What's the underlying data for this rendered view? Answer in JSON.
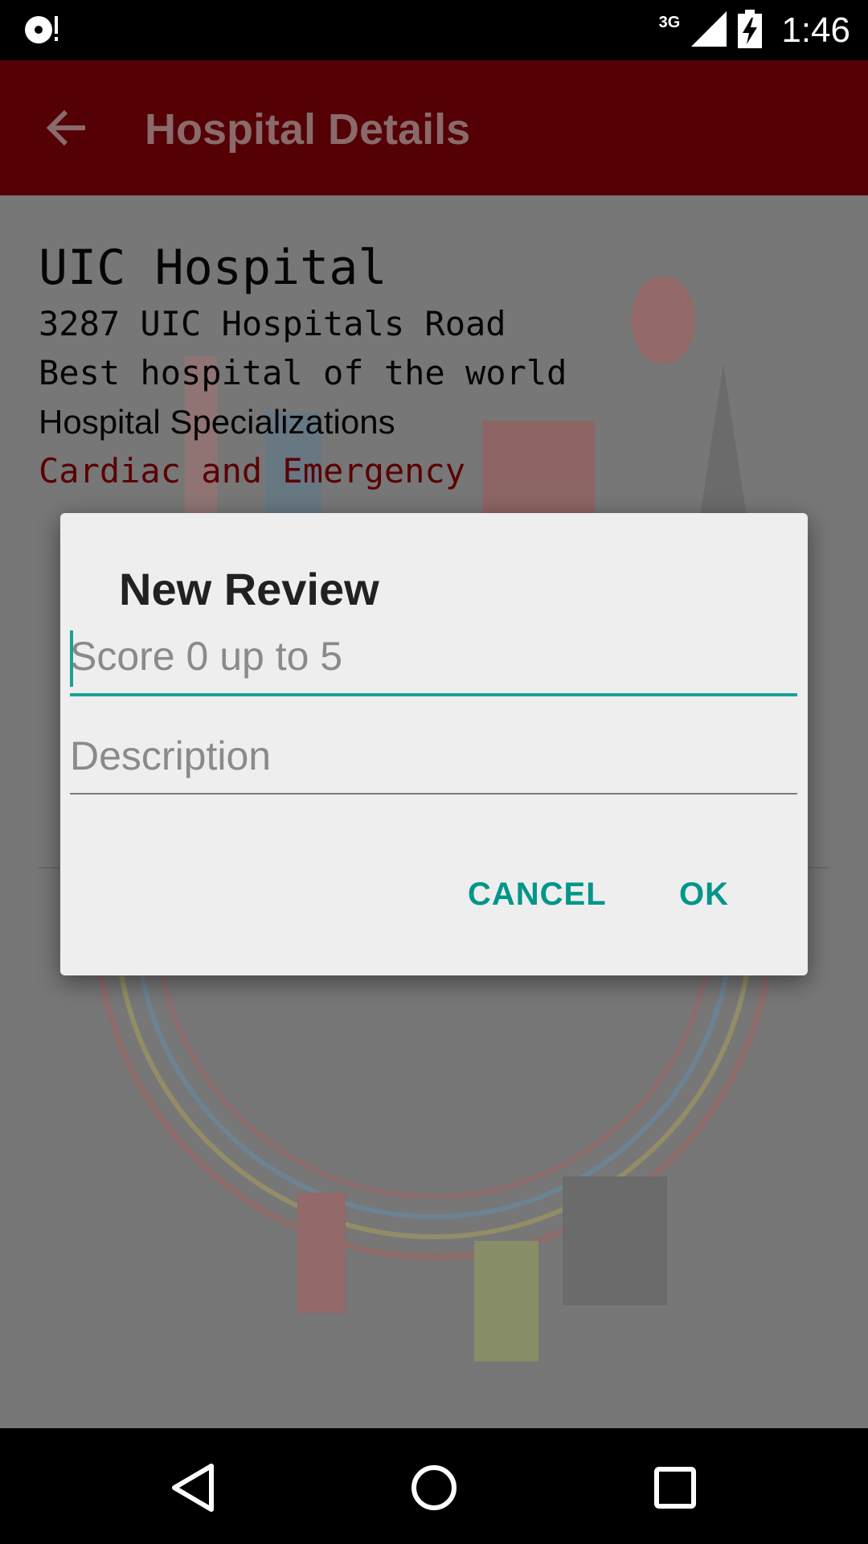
{
  "status_bar": {
    "network_type": "3G",
    "time": "1:46"
  },
  "toolbar": {
    "title": "Hospital Details",
    "back_icon": "arrow-back-icon"
  },
  "hospital": {
    "name": "UIC Hospital",
    "address": "3287 UIC Hospitals Road",
    "description": "Best hospital of the world",
    "specializations_label": "Hospital Specializations",
    "specializations": "Cardiac and Emergency"
  },
  "dialog": {
    "title": "New Review",
    "score_placeholder": "Score 0 up to 5",
    "score_value": "",
    "description_placeholder": "Description",
    "description_value": "",
    "cancel_label": "CANCEL",
    "ok_label": "OK",
    "accent_color": "#00968a"
  },
  "nav_bar": {
    "back_icon": "triangle-back-icon",
    "home_icon": "circle-home-icon",
    "recents_icon": "square-recents-icon"
  },
  "colors": {
    "toolbar": "#540005",
    "specializations_text": "#5a0004"
  }
}
